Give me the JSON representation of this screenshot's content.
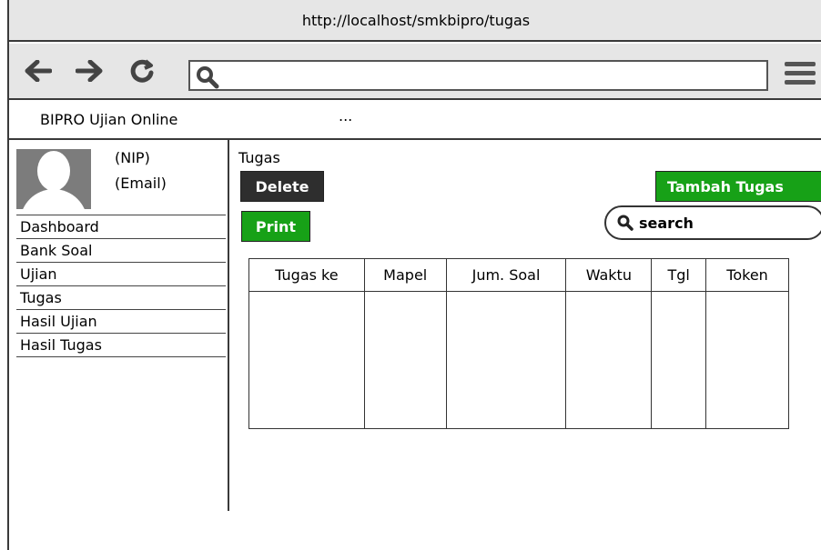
{
  "browser": {
    "url": "http://localhost/smkbipro/tugas",
    "address_value": ""
  },
  "navbar": {
    "brand": "BIPRO Ujian Online",
    "more": "..."
  },
  "user": {
    "nip": "(NIP)",
    "email": "(Email)"
  },
  "sidebar": {
    "items": [
      {
        "label": "Dashboard"
      },
      {
        "label": "Bank Soal"
      },
      {
        "label": "Ujian"
      },
      {
        "label": "Tugas"
      },
      {
        "label": "Hasil Ujian"
      },
      {
        "label": "Hasil Tugas"
      }
    ]
  },
  "main": {
    "title": "Tugas",
    "delete_label": "Delete",
    "print_label": "Print",
    "add_label": "Tambah Tugas",
    "search_placeholder": "search"
  },
  "table": {
    "columns": [
      "Tugas ke",
      "Mapel",
      "Jum. Soal",
      "Waktu",
      "Tgl",
      "Token"
    ]
  },
  "colors": {
    "primary_green": "#17a117",
    "dark_button": "#2e2e2e",
    "chrome_gray": "#e6e6e6"
  }
}
